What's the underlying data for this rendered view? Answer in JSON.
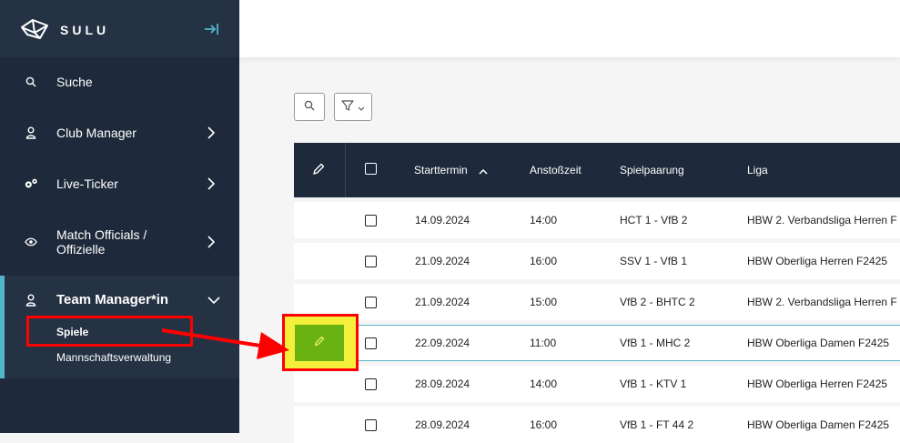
{
  "app": {
    "name": "SULU"
  },
  "sidebar": {
    "items": [
      {
        "label": "Suche",
        "icon": "search-icon"
      },
      {
        "label": "Club Manager",
        "icon": "user-icon"
      },
      {
        "label": "Live-Ticker",
        "icon": "gears-icon"
      },
      {
        "label": "Match Officials / Offizielle",
        "label_line1": "Match Officials /",
        "label_line2": "Offizielle",
        "icon": "eye-icon"
      },
      {
        "label": "Team Manager*in",
        "icon": "user-icon",
        "expanded": true,
        "children": [
          {
            "label": "Spiele",
            "active": true
          },
          {
            "label": "Mannschaftsverwaltung"
          }
        ]
      }
    ]
  },
  "toolbar": {
    "search_icon": "search-icon",
    "filter_icon": "filter-icon"
  },
  "table": {
    "columns": [
      "Starttermin",
      "Anstoßzeit",
      "Spielpaarung",
      "Liga"
    ],
    "rows": [
      {
        "date": "14.09.2024",
        "time": "14:00",
        "match": "HCT 1 - VfB 2",
        "league": "HBW 2. Verbandsliga Herren F"
      },
      {
        "date": "21.09.2024",
        "time": "16:00",
        "match": "SSV 1 - VfB 1",
        "league": "HBW Oberliga Herren F2425"
      },
      {
        "date": "21.09.2024",
        "time": "15:00",
        "match": "VfB 2 - BHTC 2",
        "league": "HBW 2. Verbandsliga Herren F"
      },
      {
        "date": "22.09.2024",
        "time": "11:00",
        "match": "VfB 1 - MHC 2",
        "league": "HBW Oberliga Damen F2425"
      },
      {
        "date": "28.09.2024",
        "time": "14:00",
        "match": "VfB 1 - KTV 1",
        "league": "HBW Oberliga Herren F2425"
      },
      {
        "date": "28.09.2024",
        "time": "16:00",
        "match": "VfB 1 - FT 44 2",
        "league": "HBW Oberliga Damen F2425"
      }
    ]
  },
  "colors": {
    "sidebar": "#1e2a3b",
    "accent": "#52b6ca",
    "edit": "#6ab211",
    "annotation": "#ff0000"
  }
}
